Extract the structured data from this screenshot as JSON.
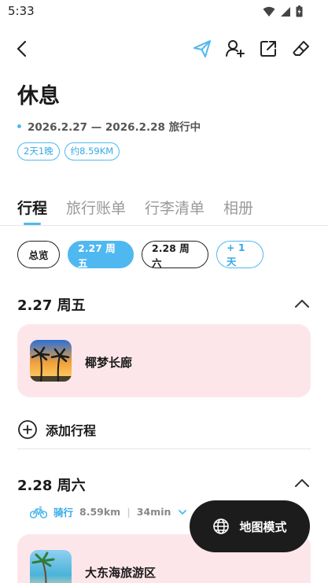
{
  "status": {
    "time": "5:33"
  },
  "trip": {
    "title": "休息",
    "dates": "2026.2.27 — 2026.2.28 旅行中",
    "tags": [
      "2天1晚",
      "约8.59KM"
    ]
  },
  "tabs": [
    {
      "label": "行程",
      "active": true
    },
    {
      "label": "旅行账单",
      "active": false
    },
    {
      "label": "行李清单",
      "active": false
    },
    {
      "label": "相册",
      "active": false
    }
  ],
  "day_chips": [
    {
      "label": "总览",
      "active": false
    },
    {
      "label": "2.27 周五",
      "active": true
    },
    {
      "label": "2.28 周六",
      "active": false
    },
    {
      "label": "+ 1 天",
      "active": false
    }
  ],
  "days": [
    {
      "header": "2.27 周五",
      "items": [
        {
          "name": "椰梦长廊"
        }
      ]
    },
    {
      "header": "2.28 周六",
      "items": [
        {
          "name": "大东海旅游区"
        }
      ]
    }
  ],
  "add_item_label": "添加行程",
  "route": {
    "mode": "骑行",
    "distance": "8.59km",
    "duration": "34min"
  },
  "map_button_label": "地图模式",
  "colors": {
    "accent": "#4fb8f0",
    "card_bg": "#fde6ea",
    "map_button_bg": "#1c1c1c"
  }
}
